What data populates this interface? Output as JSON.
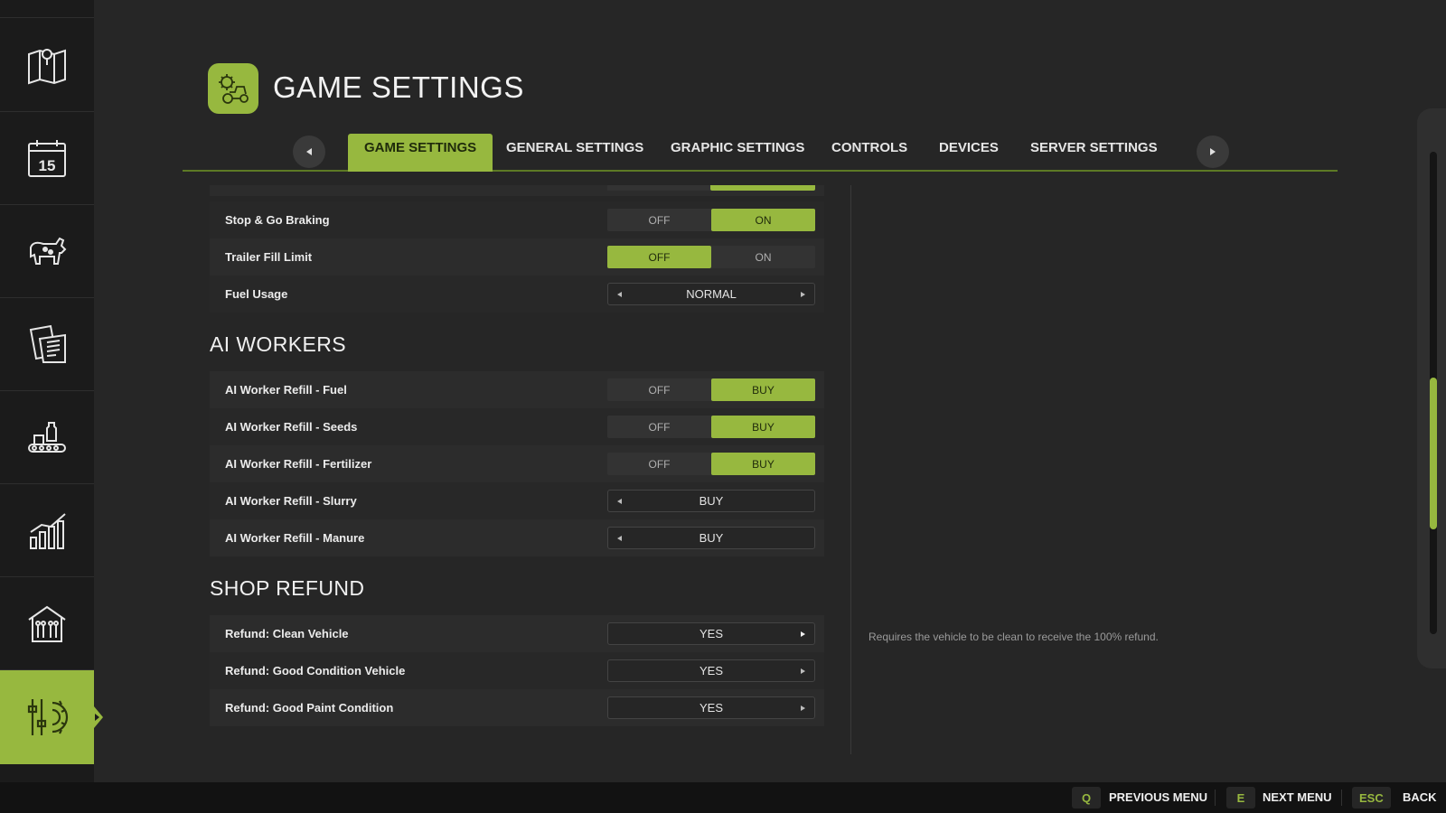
{
  "header": {
    "title": "GAME SETTINGS"
  },
  "tabs": [
    {
      "label": "GAME SETTINGS",
      "active": true
    },
    {
      "label": "GENERAL SETTINGS",
      "active": false
    },
    {
      "label": "GRAPHIC SETTINGS",
      "active": false
    },
    {
      "label": "CONTROLS",
      "active": false
    },
    {
      "label": "DEVICES",
      "active": false
    },
    {
      "label": "SERVER SETTINGS",
      "active": false
    }
  ],
  "sidebar": {
    "items": [
      {
        "icon": "map-icon"
      },
      {
        "icon": "calendar-icon",
        "value": "15"
      },
      {
        "icon": "animals-icon"
      },
      {
        "icon": "contracts-icon"
      },
      {
        "icon": "production-icon"
      },
      {
        "icon": "statistics-icon"
      },
      {
        "icon": "farm-building-icon"
      },
      {
        "icon": "settings-sliders-icon",
        "active": true
      }
    ]
  },
  "settings": {
    "rows_top": [
      {
        "label": "Stop & Go Braking",
        "type": "toggle",
        "options": [
          "OFF",
          "ON"
        ],
        "selected": 1
      },
      {
        "label": "Trailer Fill Limit",
        "type": "toggle",
        "options": [
          "OFF",
          "ON"
        ],
        "selected": 0
      },
      {
        "label": "Fuel Usage",
        "type": "selector",
        "value": "NORMAL"
      }
    ],
    "ai_workers": {
      "title": "AI WORKERS",
      "rows": [
        {
          "label": "AI Worker Refill - Fuel",
          "type": "toggle",
          "options": [
            "OFF",
            "BUY"
          ],
          "selected": 1
        },
        {
          "label": "AI Worker Refill - Seeds",
          "type": "toggle",
          "options": [
            "OFF",
            "BUY"
          ],
          "selected": 1
        },
        {
          "label": "AI Worker Refill - Fertilizer",
          "type": "toggle",
          "options": [
            "OFF",
            "BUY"
          ],
          "selected": 1
        },
        {
          "label": "AI Worker Refill - Slurry",
          "type": "selector",
          "value": "BUY"
        },
        {
          "label": "AI Worker Refill - Manure",
          "type": "selector",
          "value": "BUY"
        }
      ]
    },
    "shop_refund": {
      "title": "SHOP REFUND",
      "rows": [
        {
          "label": "Refund: Clean Vehicle",
          "type": "selector",
          "value": "YES"
        },
        {
          "label": "Refund: Good Condition Vehicle",
          "type": "selector",
          "value": "YES"
        },
        {
          "label": "Refund: Good Paint Condition",
          "type": "selector",
          "value": "YES"
        }
      ]
    }
  },
  "description": {
    "text": "Requires the vehicle to be clean to receive the 100% refund."
  },
  "scrollbar": {
    "position_fraction": 0.47
  },
  "footer": {
    "prev_key": "Q",
    "prev_label": "PREVIOUS MENU",
    "next_key": "E",
    "next_label": "NEXT MENU",
    "back_key": "ESC",
    "back_label": "BACK"
  },
  "colors": {
    "accent": "#97b83f",
    "background": "#262626",
    "sidebar": "#1b1b1b"
  }
}
